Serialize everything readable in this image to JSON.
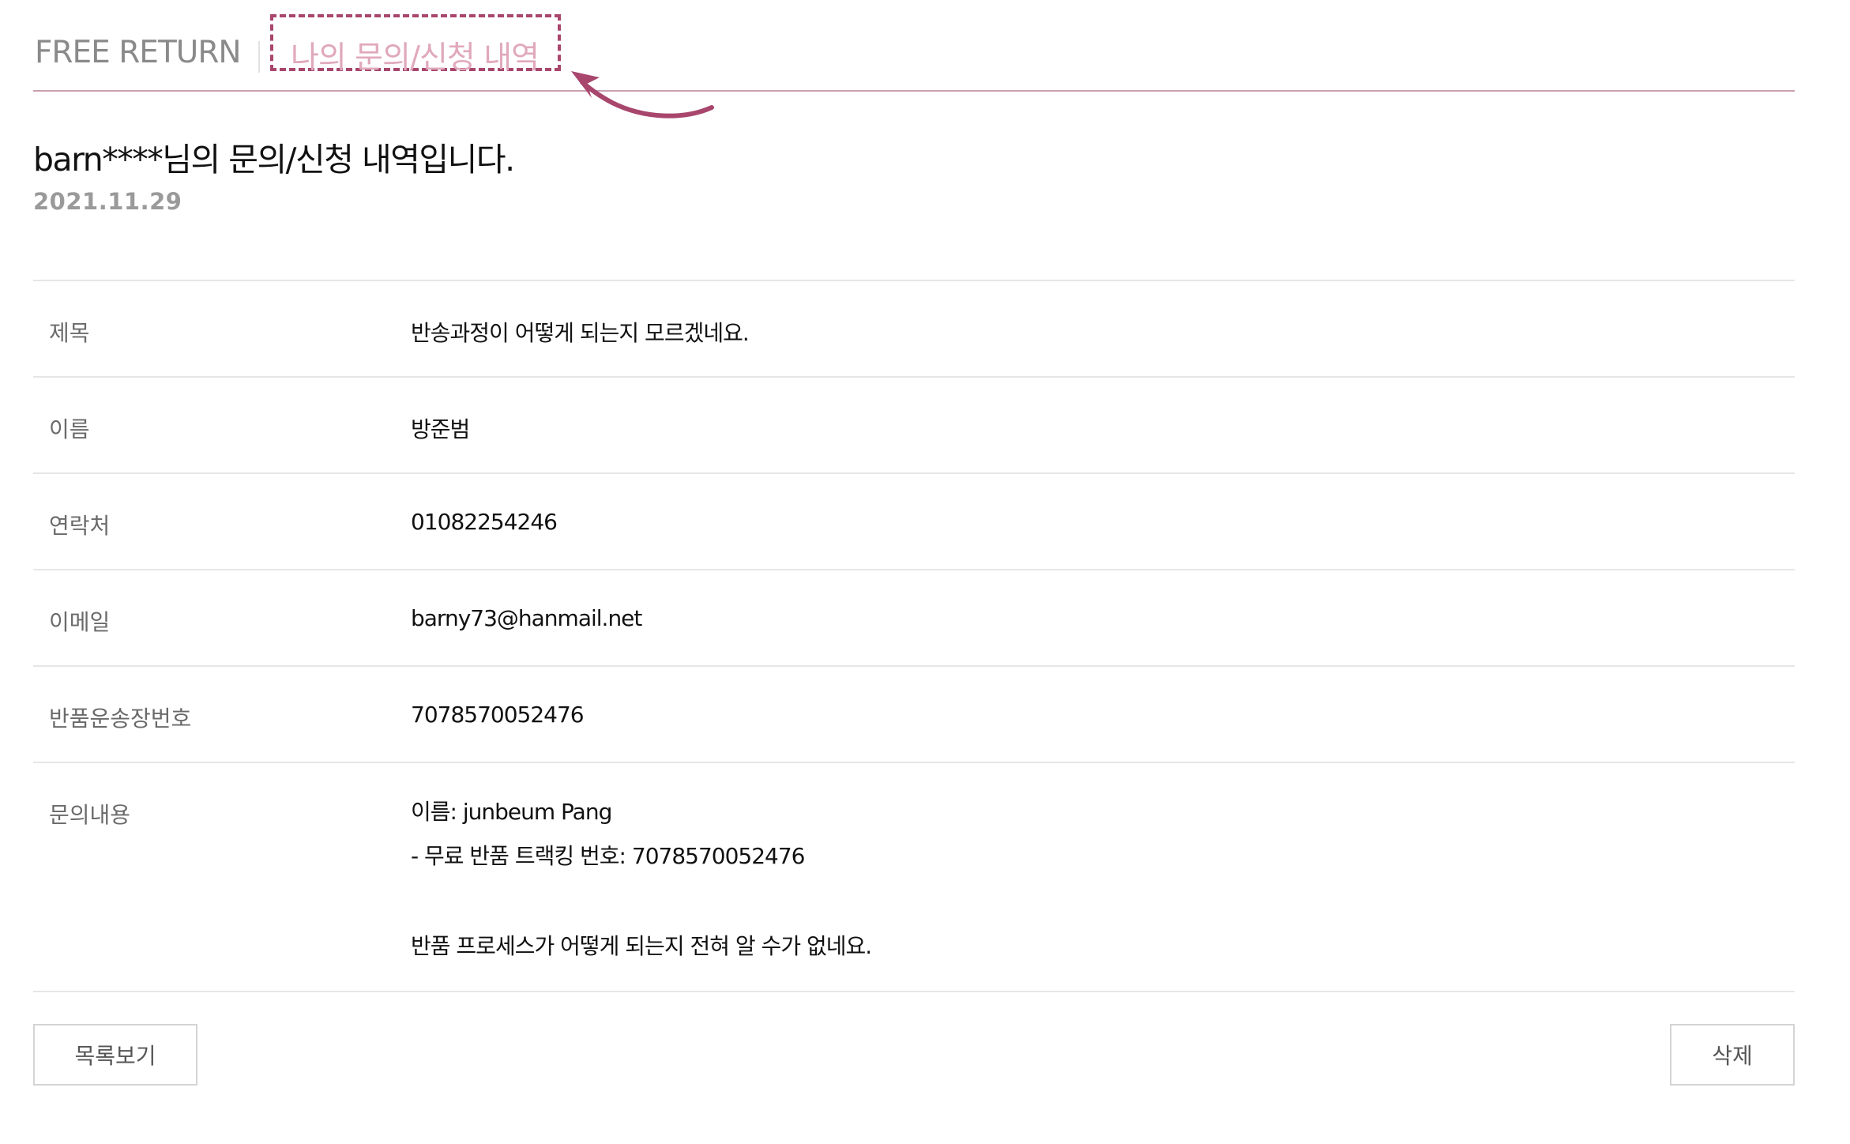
{
  "tabs": {
    "free_return": "FREE RETURN",
    "my_inquiries": "나의 문의/신청 내역"
  },
  "colors": {
    "accent": "#a8466d",
    "tab_active_text": "#e0a9bb",
    "tab_inactive_text": "#8a8a8a",
    "divider": "#c9a0b1"
  },
  "icons": {
    "annotation_arrow": "hand-drawn-arrow-icon"
  },
  "page": {
    "heading": "barn****님의 문의/신청 내역입니다.",
    "date": "2021.11.29"
  },
  "details": [
    {
      "label": "제목",
      "value": "반송과정이 어떻게 되는지 모르겠네요."
    },
    {
      "label": "이름",
      "value": "방준범"
    },
    {
      "label": "연락처",
      "value": "01082254246"
    },
    {
      "label": "이메일",
      "value": "barny73@hanmail.net"
    },
    {
      "label": "반품운송장번호",
      "value": "7078570052476"
    }
  ],
  "inquiry": {
    "label": "문의내용",
    "lines": [
      " 이름: junbeum Pang",
      "- 무료 반품 트랙킹 번호:  7078570052476",
      "",
      "반품 프로세스가 어떻게 되는지 전혀 알 수가 없네요."
    ]
  },
  "buttons": {
    "list": "목록보기",
    "delete": "삭제"
  }
}
